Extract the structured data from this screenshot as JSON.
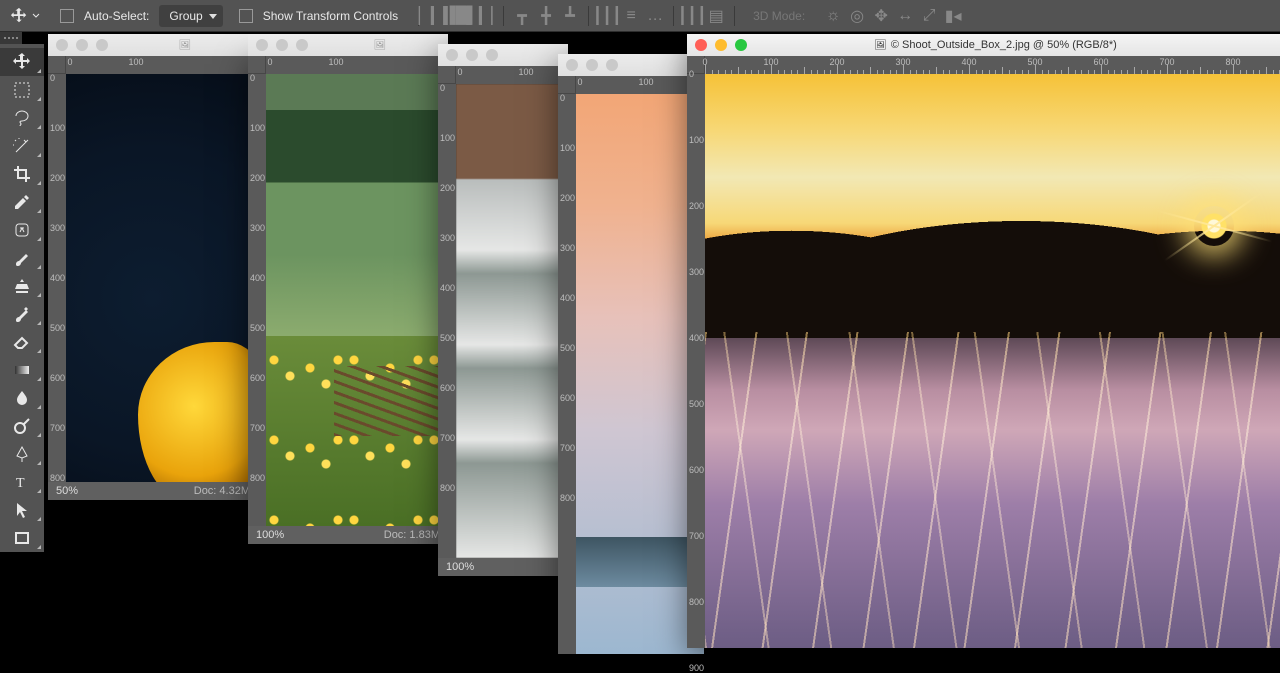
{
  "options": {
    "auto_select_label": "Auto-Select:",
    "auto_select_value": "Group",
    "show_transform_label": "Show Transform Controls",
    "mode3d_label": "3D Mode:"
  },
  "tools": [
    "move",
    "marquee",
    "lasso",
    "magic-wand",
    "crop",
    "eyedropper",
    "healing-brush",
    "brush",
    "clone-stamp",
    "history-brush",
    "eraser",
    "gradient",
    "blur",
    "dodge",
    "pen",
    "type",
    "path-select",
    "rectangle"
  ],
  "ruler_marks": [
    "0",
    "100",
    "200",
    "300",
    "400",
    "500",
    "600",
    "700",
    "800"
  ],
  "docs": [
    {
      "id": "d1",
      "zoom": "50%",
      "doc": "Doc: 4.32M",
      "active": false
    },
    {
      "id": "d2",
      "zoom": "100%",
      "doc": "Doc: 1.83M",
      "active": false
    },
    {
      "id": "d3",
      "zoom": "100%",
      "doc": "",
      "active": false
    },
    {
      "id": "d4",
      "zoom": "",
      "doc": "",
      "active": false
    },
    {
      "id": "d5",
      "title": "© Shoot_Outside_Box_2.jpg @ 50% (RGB/8*)",
      "zoom": "",
      "doc": "",
      "active": true
    }
  ]
}
